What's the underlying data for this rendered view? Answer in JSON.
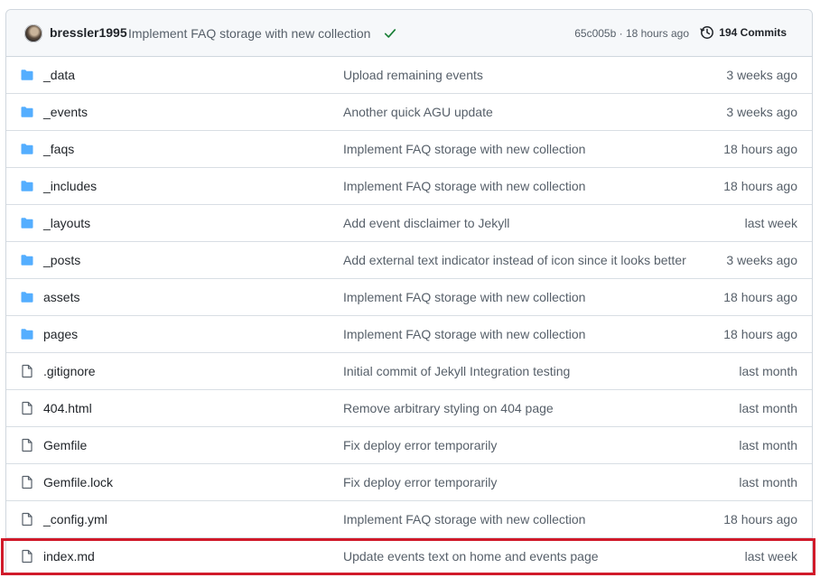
{
  "latest_commit": {
    "author": "bressler1995",
    "message": "Implement FAQ storage with new collection",
    "status": "success",
    "hash_time": "65c005b · 18 hours ago",
    "commits_label": "194 Commits"
  },
  "files": [
    {
      "type": "folder",
      "name": "_data",
      "message": "Upload remaining events",
      "age": "3 weeks ago"
    },
    {
      "type": "folder",
      "name": "_events",
      "message": "Another quick AGU update",
      "age": "3 weeks ago"
    },
    {
      "type": "folder",
      "name": "_faqs",
      "message": "Implement FAQ storage with new collection",
      "age": "18 hours ago"
    },
    {
      "type": "folder",
      "name": "_includes",
      "message": "Implement FAQ storage with new collection",
      "age": "18 hours ago"
    },
    {
      "type": "folder",
      "name": "_layouts",
      "message": "Add event disclaimer to Jekyll",
      "age": "last week"
    },
    {
      "type": "folder",
      "name": "_posts",
      "message": "Add external text indicator instead of icon since it looks better",
      "age": "3 weeks ago"
    },
    {
      "type": "folder",
      "name": "assets",
      "message": "Implement FAQ storage with new collection",
      "age": "18 hours ago"
    },
    {
      "type": "folder",
      "name": "pages",
      "message": "Implement FAQ storage with new collection",
      "age": "18 hours ago"
    },
    {
      "type": "file",
      "name": ".gitignore",
      "message": "Initial commit of Jekyll Integration testing",
      "age": "last month"
    },
    {
      "type": "file",
      "name": "404.html",
      "message": "Remove arbitrary styling on 404 page",
      "age": "last month"
    },
    {
      "type": "file",
      "name": "Gemfile",
      "message": "Fix deploy error temporarily",
      "age": "last month"
    },
    {
      "type": "file",
      "name": "Gemfile.lock",
      "message": "Fix deploy error temporarily",
      "age": "last month"
    },
    {
      "type": "file",
      "name": "_config.yml",
      "message": "Implement FAQ storage with new collection",
      "age": "18 hours ago"
    },
    {
      "type": "file",
      "name": "index.md",
      "message": "Update events text on home and events page",
      "age": "last week"
    }
  ],
  "highlighted_row": "index.md",
  "colors": {
    "folder_icon": "#54aeff",
    "file_icon": "#57606a",
    "check": "#1a7f37",
    "highlight": "#d11a2a"
  }
}
